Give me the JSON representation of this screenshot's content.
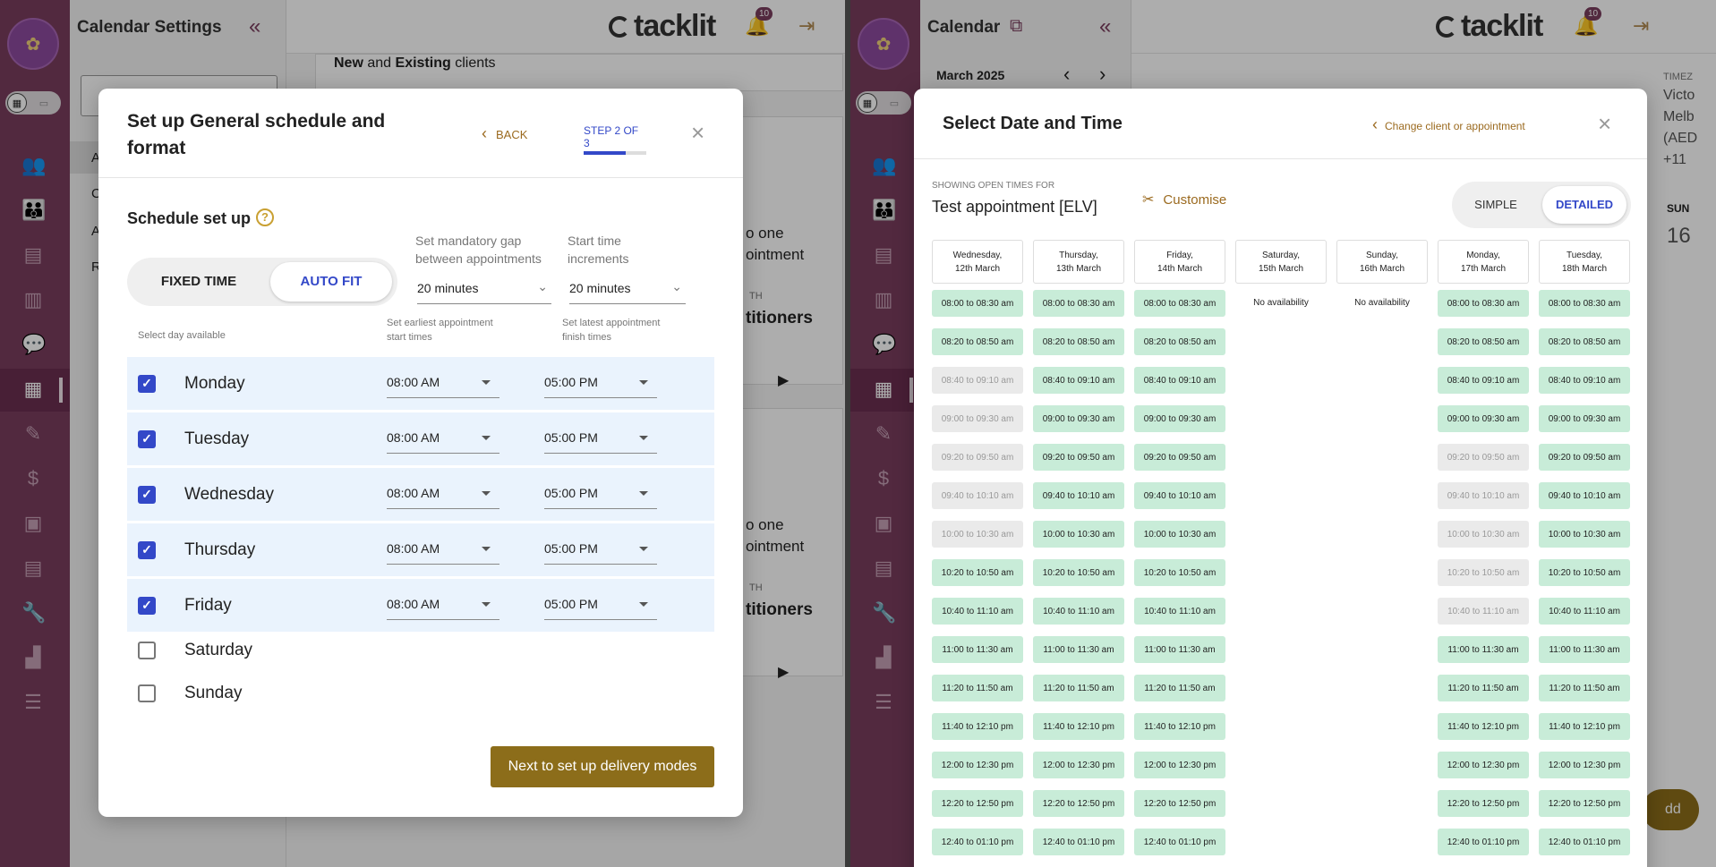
{
  "left": {
    "panel_title": "Calendar Settings",
    "brand": "tacklit",
    "notification_count": "10",
    "behind_text": {
      "new_label": "New",
      "and_label": "and",
      "existing_label": "Existing",
      "clients_label": "clients",
      "frag_one1": "o one",
      "frag_ptment1": "ointment",
      "frag_th1": "TH",
      "frag_tioners1": "titioners",
      "frag_one2": "o one",
      "frag_ptment2": "ointment",
      "frag_th2": "TH",
      "frag_tioners2": "titioners",
      "frag_a": "A",
      "frag_c": "C",
      "frag_a2": "A",
      "frag_r": "R"
    },
    "modal": {
      "title": "Set up General schedule and format",
      "back": "BACK",
      "step": "STEP 2 OF 3",
      "step_progress": 0.67,
      "section_title": "Schedule set up",
      "help_icon": "question-circle-icon",
      "mode_fixed": "FIXED TIME",
      "mode_auto": "AUTO FIT",
      "selected_mode": "AUTO FIT",
      "gap_label": "Set mandatory gap between appointments",
      "gap_value": "20 minutes",
      "increment_label": "Start time increments",
      "increment_value": "20 minutes",
      "col_day": "Select day available",
      "col_start": "Set earliest appointment start times",
      "col_finish": "Set latest appointment finish times",
      "days": [
        {
          "name": "Monday",
          "checked": true,
          "start": "08:00 AM",
          "end": "05:00 PM"
        },
        {
          "name": "Tuesday",
          "checked": true,
          "start": "08:00 AM",
          "end": "05:00 PM"
        },
        {
          "name": "Wednesday",
          "checked": true,
          "start": "08:00 AM",
          "end": "05:00 PM"
        },
        {
          "name": "Thursday",
          "checked": true,
          "start": "08:00 AM",
          "end": "05:00 PM"
        },
        {
          "name": "Friday",
          "checked": true,
          "start": "08:00 AM",
          "end": "05:00 PM"
        },
        {
          "name": "Saturday",
          "checked": false
        },
        {
          "name": "Sunday",
          "checked": false
        }
      ],
      "next_button": "Next to set up delivery modes"
    }
  },
  "right": {
    "panel_title": "Calendar",
    "month": "March",
    "year": "2025",
    "brand": "tacklit",
    "notification_count": "10",
    "behind_text": {
      "timezone": "TIMEZ",
      "tz1": "Victo",
      "tz2": "Melb",
      "tz3": "(AED",
      "tz4": "+11",
      "sun": "SUN",
      "sun_date": "16",
      "add": "dd"
    },
    "modal": {
      "title": "Select Date and Time",
      "change_link": "Change client or appointment",
      "showing_label": "SHOWING OPEN TIMES FOR",
      "appointment": "Test appointment [ELV]",
      "customise": "Customise",
      "view_simple": "SIMPLE",
      "view_detailed": "DETAILED",
      "selected_view": "DETAILED",
      "no_availability": "No availability",
      "columns": [
        {
          "day": "Wednesday,",
          "date": "12th March"
        },
        {
          "day": "Thursday,",
          "date": "13th March"
        },
        {
          "day": "Friday,",
          "date": "14th March"
        },
        {
          "day": "Saturday,",
          "date": "15th March"
        },
        {
          "day": "Sunday,",
          "date": "16th March"
        },
        {
          "day": "Monday,",
          "date": "17th March"
        },
        {
          "day": "Tuesday,",
          "date": "18th March"
        }
      ],
      "slot_labels": [
        "08:00 to 08:30 am",
        "08:20 to 08:50 am",
        "08:40 to 09:10 am",
        "09:00 to 09:30 am",
        "09:20 to 09:50 am",
        "09:40 to 10:10 am",
        "10:00 to 10:30 am",
        "10:20 to 10:50 am",
        "10:40 to 11:10 am",
        "11:00 to 11:30 am",
        "11:20 to 11:50 am",
        "11:40 to 12:10 pm",
        "12:00 to 12:30 pm",
        "12:20 to 12:50 pm",
        "12:40 to 01:10 pm"
      ],
      "unavailable": {
        "0": [
          2,
          3,
          4,
          5,
          6
        ],
        "5": [
          4,
          5,
          6,
          7,
          8
        ]
      },
      "no_slots_columns": [
        3,
        4
      ]
    }
  }
}
